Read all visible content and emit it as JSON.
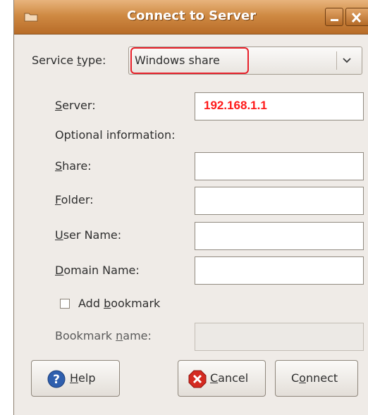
{
  "window": {
    "title": "Connect to Server"
  },
  "service": {
    "label_prefix": "Service ",
    "label_mnemonic": "t",
    "label_suffix": "ype:",
    "selected": "Windows share"
  },
  "fields": {
    "server": {
      "mnemonic": "S",
      "rest": "erver:",
      "value": "192.168.1.1"
    },
    "optional_header": "Optional information:",
    "share": {
      "mnemonic": "S",
      "rest": "hare:",
      "value": ""
    },
    "folder": {
      "mnemonic": "F",
      "rest": "older:",
      "value": ""
    },
    "user_name": {
      "mnemonic": "U",
      "rest": "ser Name:",
      "value": ""
    },
    "domain_name": {
      "mnemonic": "D",
      "rest": "omain Name:",
      "value": ""
    }
  },
  "bookmark": {
    "checkbox_prefix": "Add ",
    "checkbox_mnemonic": "b",
    "checkbox_suffix": "ookmark",
    "checked": false,
    "name_prefix": "Bookmark ",
    "name_mnemonic": "n",
    "name_suffix": "ame:",
    "name_value": ""
  },
  "buttons": {
    "help": {
      "mnemonic": "H",
      "rest": "elp"
    },
    "cancel": {
      "mnemonic": "C",
      "rest": "ancel"
    },
    "connect": {
      "prefix": "C",
      "mnemonic": "o",
      "rest": "nnect"
    }
  },
  "colors": {
    "titlebar": "#cf8a43",
    "highlight_border": "#e8202a",
    "server_text": "#ff1a1a",
    "help_icon": "#2f5fae",
    "cancel_icon": "#d42a20"
  },
  "icons": {
    "title": "folder-icon",
    "minimize": "minimize-icon",
    "close": "close-icon",
    "dropdown": "chevron-down-icon",
    "help": "help-icon",
    "cancel": "cancel-icon"
  }
}
